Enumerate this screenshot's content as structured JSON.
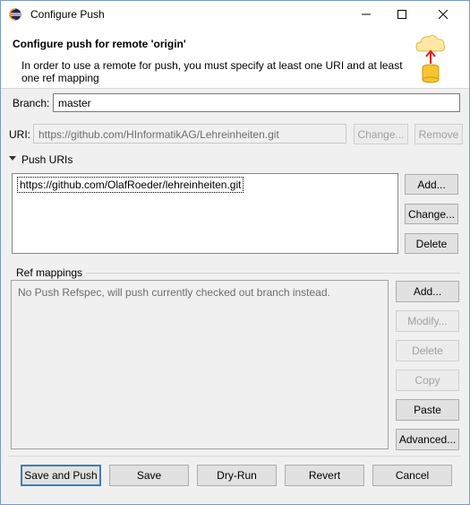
{
  "window": {
    "title": "Configure Push",
    "controls": {
      "minimize": "–",
      "maximize": "☐",
      "close": "✕"
    }
  },
  "header": {
    "title": "Configure push for remote 'origin'",
    "message": "In order to use a remote for push, you must specify at least one URI and at least one ref mapping",
    "image_icon": "cloud-database-icon"
  },
  "branch": {
    "label": "Branch:",
    "value": "master"
  },
  "uri": {
    "label": "URI:",
    "value": "https://github.com/HInformatikAG/Lehreinheiten.git",
    "change_label": "Change...",
    "remove_label": "Remove"
  },
  "push_uris": {
    "label": "Push URIs",
    "items": [
      "https://github.com/OlafRoeder/lehreinheiten.git"
    ],
    "add_label": "Add...",
    "change_label": "Change...",
    "delete_label": "Delete"
  },
  "ref_mappings": {
    "label": "Ref mappings",
    "placeholder": "No Push Refspec, will push currently checked out branch instead.",
    "add_label": "Add...",
    "modify_label": "Modify...",
    "delete_label": "Delete",
    "copy_label": "Copy",
    "paste_label": "Paste",
    "advanced_label": "Advanced..."
  },
  "footer": {
    "save_and_push": "Save and Push",
    "save": "Save",
    "dry_run": "Dry-Run",
    "revert": "Revert",
    "cancel": "Cancel"
  },
  "colors": {
    "accent": "#3c7fb1",
    "window_border": "#7a9cc6",
    "disabled_text": "#a0a0a0"
  }
}
